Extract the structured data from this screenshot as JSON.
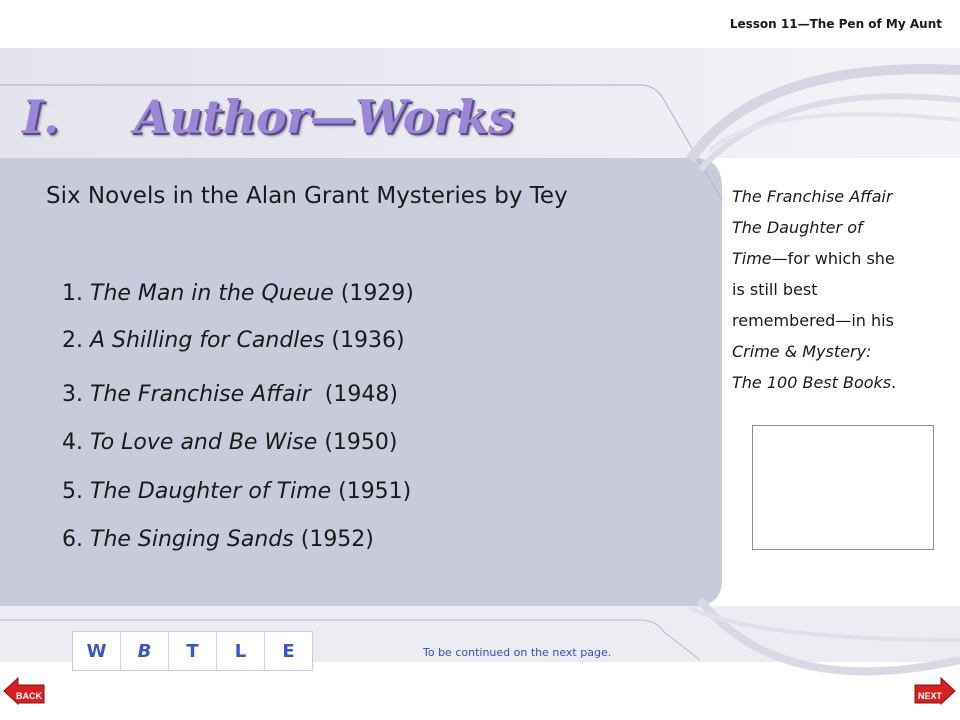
{
  "header": {
    "lesson": "Lesson 11—The Pen of My Aunt"
  },
  "title": {
    "number": "I.",
    "text": "Author—Works"
  },
  "main": {
    "subtitle": "Six Novels in the Alan Grant Mysteries by Tey",
    "novels": [
      {
        "num": "1.",
        "title": "The Man in the Queue",
        "year": "(1929)"
      },
      {
        "num": "2.",
        "title": "A Shilling for Candles",
        "year": "(1936)"
      },
      {
        "num": "3.",
        "title": "The Franchise Affair",
        "year": "(1948)"
      },
      {
        "num": "4.",
        "title": "To Love and Be Wise",
        "year": "(1950)"
      },
      {
        "num": "5.",
        "title": "The Daughter of Time",
        "year": "(1951)"
      },
      {
        "num": "6.",
        "title": "The Singing Sands",
        "year": "(1952)"
      }
    ]
  },
  "side": {
    "line1_italic": "The Franchise Affair",
    "line2_italic": "The Daughter of",
    "line3_italic": "Time",
    "line3_rest": "—for which she",
    "line4": "is still best",
    "line5": "remembered—in his",
    "line6_italic": "Crime & Mystery:",
    "line7_italic": "The 100 Best Books",
    "line7_rest": "."
  },
  "nav": {
    "buttons": [
      "W",
      "B",
      "T",
      "L",
      "E"
    ],
    "continued": "To be continued on the next page.",
    "back_label": "BACK",
    "next_label": "NEXT"
  },
  "colors": {
    "panel": "#c8cbdb",
    "title": "#9b87d6",
    "nav_text": "#3a56c4",
    "button_red": "#d92020"
  }
}
